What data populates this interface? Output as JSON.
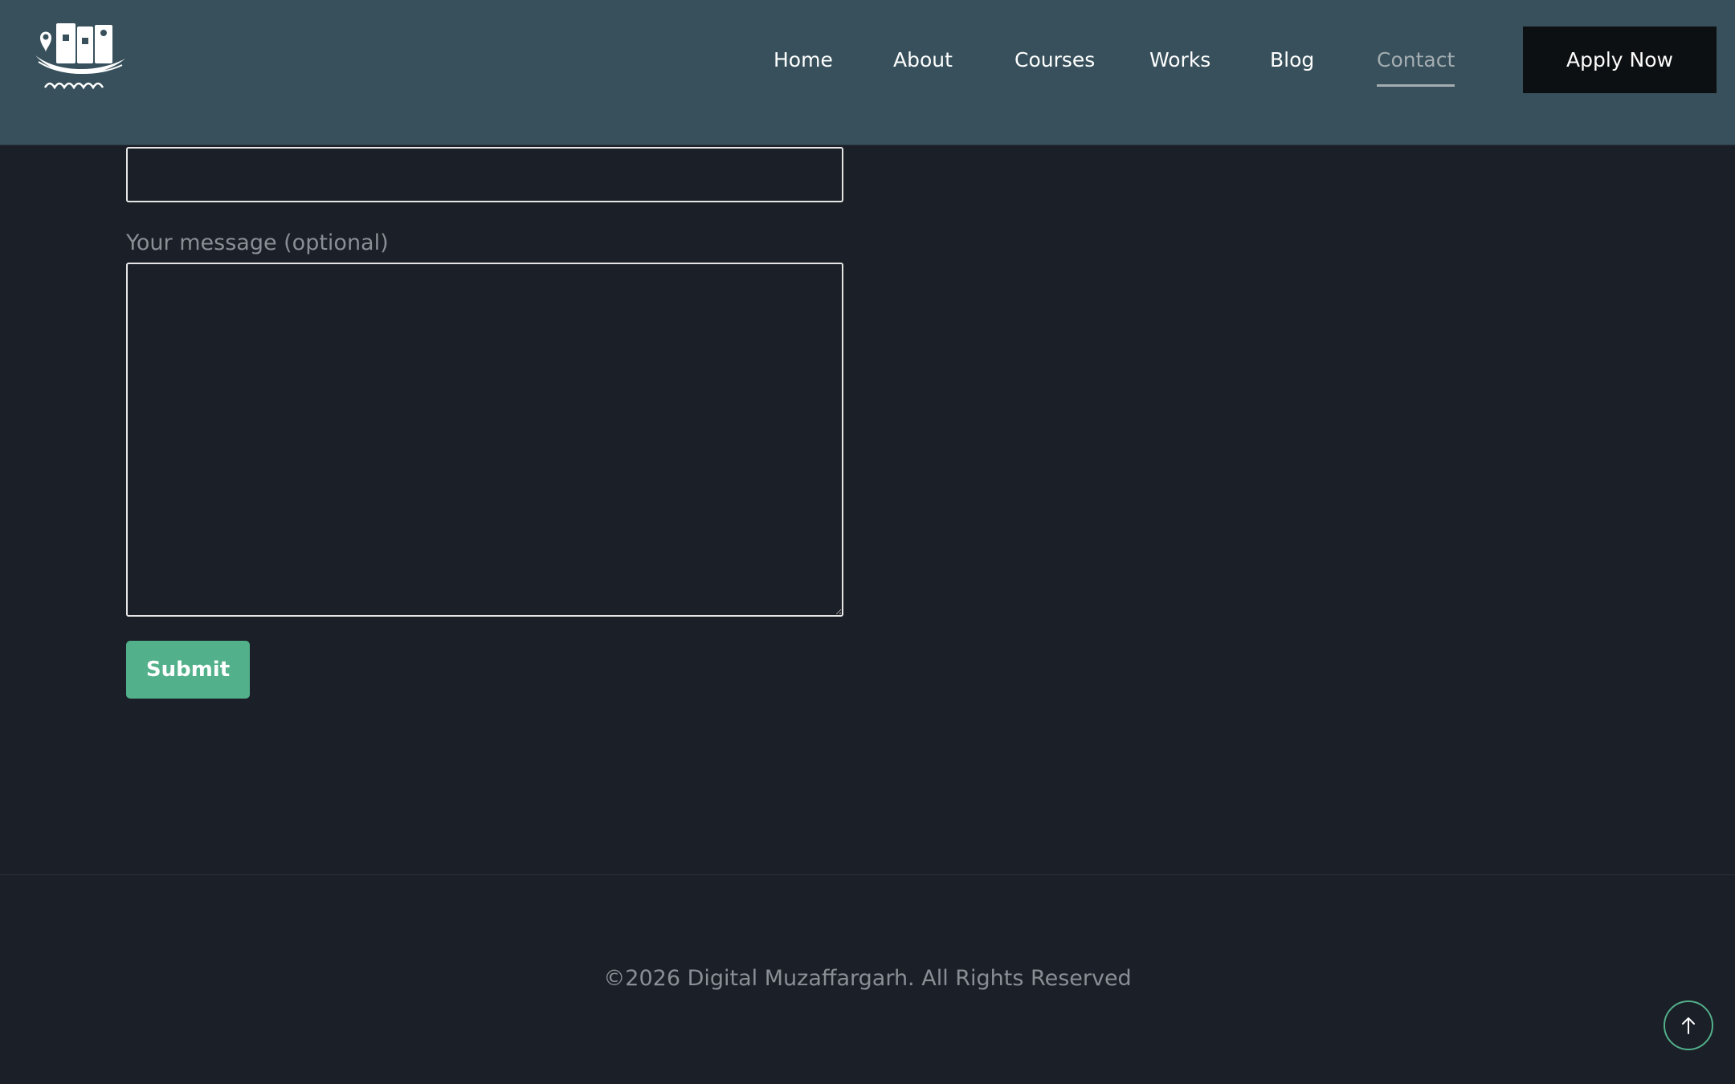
{
  "header": {
    "logo_name": "logo-icon",
    "nav": [
      {
        "label": "Home",
        "active": false
      },
      {
        "label": "About",
        "active": false
      },
      {
        "label": "Courses",
        "active": false
      },
      {
        "label": "Works",
        "active": false
      },
      {
        "label": "Blog",
        "active": false
      },
      {
        "label": "Contact",
        "active": true
      }
    ],
    "apply_label": "Apply Now"
  },
  "form": {
    "message_label": "Your message (optional)",
    "message_value": "",
    "submit_label": "Submit"
  },
  "footer": {
    "copyright": "©2026 Digital Muzaffargarh. All Rights Reserved"
  },
  "scroll_top": {
    "icon": "arrow-up-icon"
  },
  "colors": {
    "header_bg": "#37505b",
    "page_bg": "#1b1f27",
    "accent": "#52b08a",
    "apply_bg": "#0d1012",
    "muted_text": "#8a8f96"
  }
}
